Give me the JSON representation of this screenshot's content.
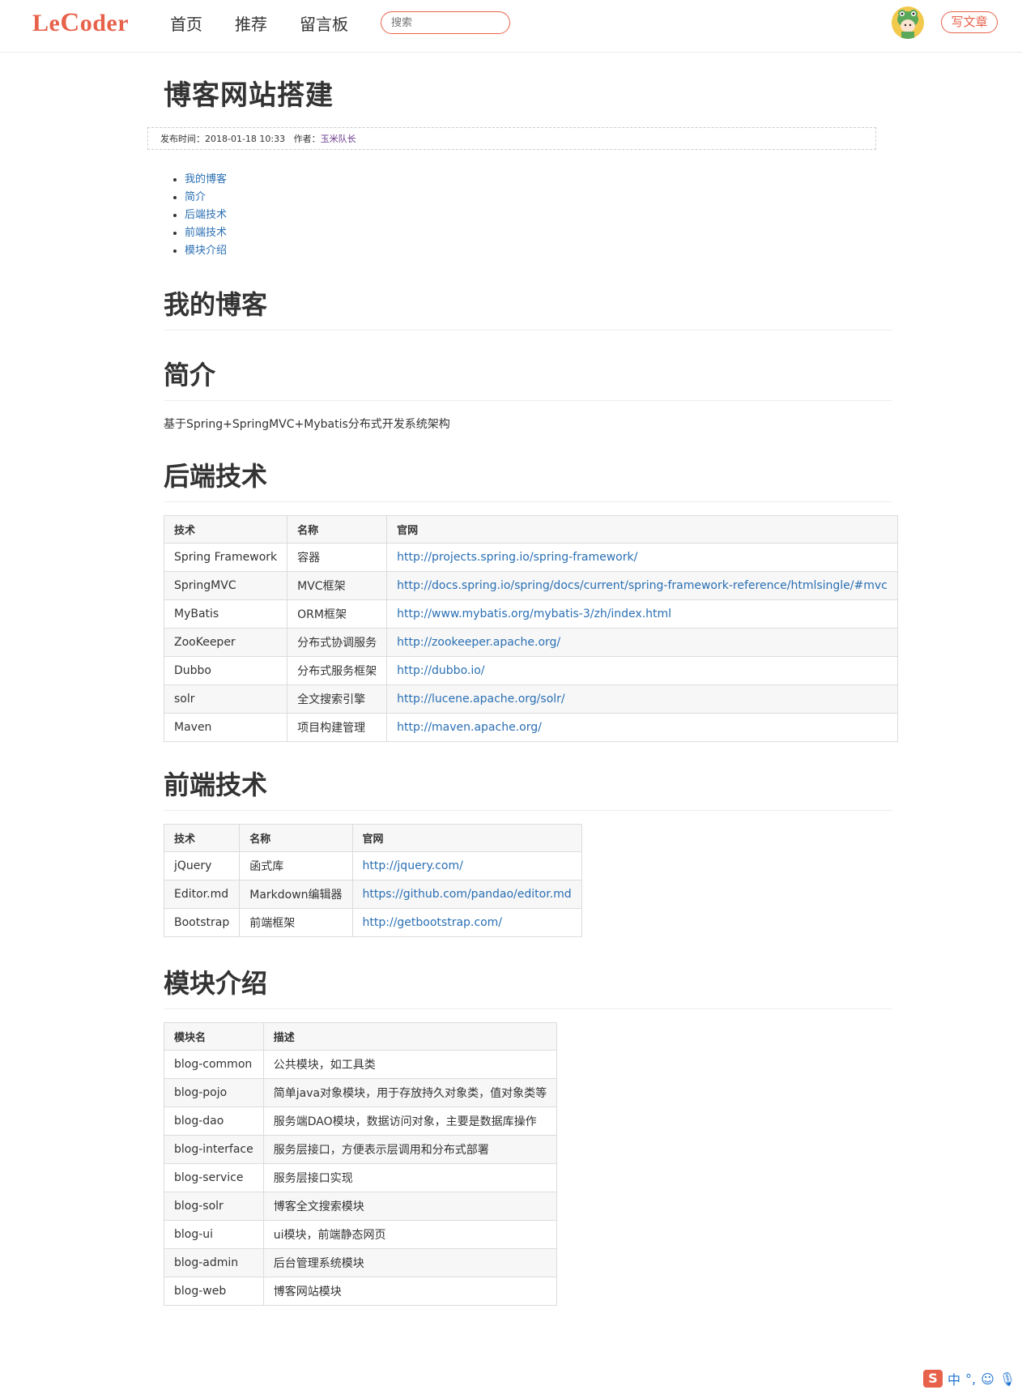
{
  "header": {
    "logo_prefix": "L",
    "logo_mid": "e",
    "logo_big": "C",
    "logo_suffix": "oder",
    "nav": [
      "首页",
      "推荐",
      "留言板"
    ],
    "search_placeholder": "搜索",
    "write_button": "写文章"
  },
  "article": {
    "title": "博客网站搭建",
    "meta_label_time": "发布时间：",
    "meta_time": "2018-01-18 10:33",
    "meta_label_author": "作者：",
    "meta_author": "玉米队长",
    "toc": [
      "我的博客",
      "简介",
      "后端技术",
      "前端技术",
      "模块介绍"
    ],
    "sections": {
      "blog": "我的博客",
      "intro": "简介",
      "intro_text": "基于Spring+SpringMVC+Mybatis分布式开发系统架构",
      "back": "后端技术",
      "front": "前端技术",
      "module": "模块介绍"
    },
    "backend_table": {
      "headers": [
        "技术",
        "名称",
        "官网"
      ],
      "rows": [
        [
          "Spring Framework",
          "容器",
          "http://projects.spring.io/spring-framework/"
        ],
        [
          "SpringMVC",
          "MVC框架",
          "http://docs.spring.io/spring/docs/current/spring-framework-reference/htmlsingle/#mvc"
        ],
        [
          "MyBatis",
          "ORM框架",
          "http://www.mybatis.org/mybatis-3/zh/index.html"
        ],
        [
          "ZooKeeper",
          "分布式协调服务",
          "http://zookeeper.apache.org/"
        ],
        [
          "Dubbo",
          "分布式服务框架",
          "http://dubbo.io/"
        ],
        [
          "solr",
          "全文搜索引擎",
          "http://lucene.apache.org/solr/"
        ],
        [
          "Maven",
          "项目构建管理",
          "http://maven.apache.org/"
        ]
      ]
    },
    "frontend_table": {
      "headers": [
        "技术",
        "名称",
        "官网"
      ],
      "rows": [
        [
          "jQuery",
          "函式库",
          "http://jquery.com/"
        ],
        [
          "Editor.md",
          "Markdown编辑器",
          "https://github.com/pandao/editor.md"
        ],
        [
          "Bootstrap",
          "前端框架",
          "http://getbootstrap.com/"
        ]
      ]
    },
    "module_table": {
      "headers": [
        "模块名",
        "描述"
      ],
      "rows": [
        [
          "blog-common",
          "公共模块，如工具类"
        ],
        [
          "blog-pojo",
          "简单java对象模块，用于存放持久对象类，值对象类等"
        ],
        [
          "blog-dao",
          "服务端DAO模块，数据访问对象，主要是数据库操作"
        ],
        [
          "blog-interface",
          "服务层接口，方便表示层调用和分布式部署"
        ],
        [
          "blog-service",
          "服务层接口实现"
        ],
        [
          "blog-solr",
          "博客全文搜索模块"
        ],
        [
          "blog-ui",
          "ui模块，前端静态网页"
        ],
        [
          "blog-admin",
          "后台管理系统模块"
        ],
        [
          "blog-web",
          "博客网站模块"
        ]
      ]
    }
  },
  "ime": {
    "logo": "S",
    "mode": "中",
    "punct": "°,"
  },
  "colors": {
    "brand": "#e8624b",
    "link": "#2a6fb3",
    "author": "#6a3a8c"
  }
}
